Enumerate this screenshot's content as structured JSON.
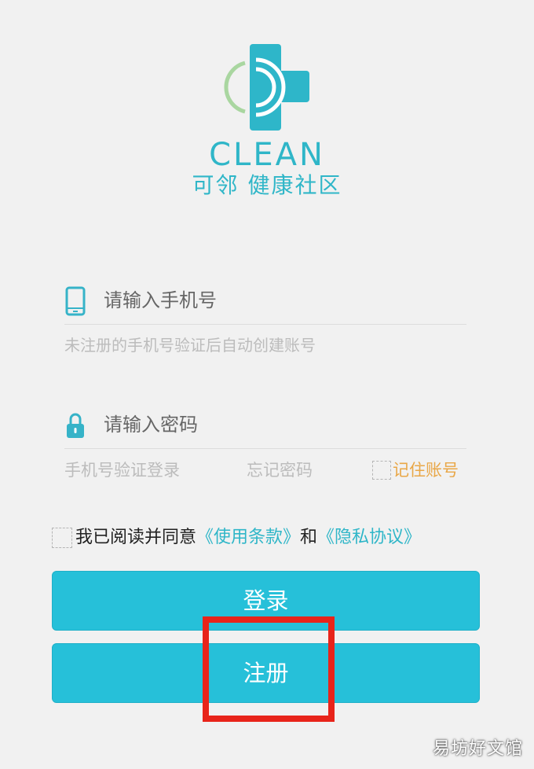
{
  "brand": {
    "wordmark": "CLEAN",
    "subtitle": "可邻 健康社区",
    "accent": "#2fb6c8",
    "cross_color": "#2eb6c9",
    "ring_color": "#a9d6a0"
  },
  "phone": {
    "placeholder": "请输入手机号",
    "icon": "phone-icon",
    "hint": "未注册的手机号验证后自动创建账号"
  },
  "password": {
    "placeholder": "请输入密码",
    "icon": "lock-icon"
  },
  "options": {
    "sms_login": "手机号验证登录",
    "forgot": "忘记密码",
    "remember": "记住账号"
  },
  "agreement": {
    "prefix": "我已阅读并同意",
    "terms": "《使用条款》",
    "and": "和",
    "privacy": "《隐私协议》"
  },
  "buttons": {
    "login": "登录",
    "register": "注册",
    "color": "#26c0d9"
  },
  "watermark": "易坊好文馆"
}
